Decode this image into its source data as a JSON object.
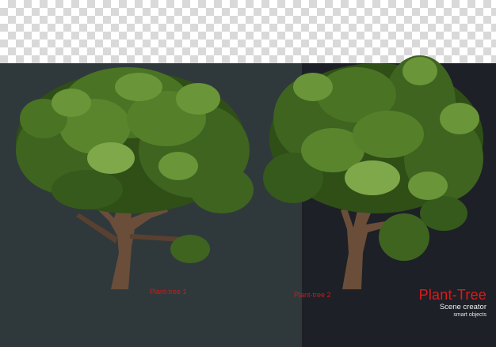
{
  "labels": {
    "tree_1": "Plant-tree 1",
    "tree_2": "Plant-tree 2"
  },
  "brand": {
    "title": "Plant-Tree",
    "subtitle": "Scene creator",
    "tagline": "smart objects"
  },
  "colors": {
    "left_panel": "#2f393c",
    "right_panel": "#1d2026",
    "label_red": "#d41818",
    "foliage_dark": "#2f4f17",
    "foliage_mid": "#4f7a25",
    "foliage_light": "#7fa84a",
    "trunk": "#6a4e3a"
  }
}
